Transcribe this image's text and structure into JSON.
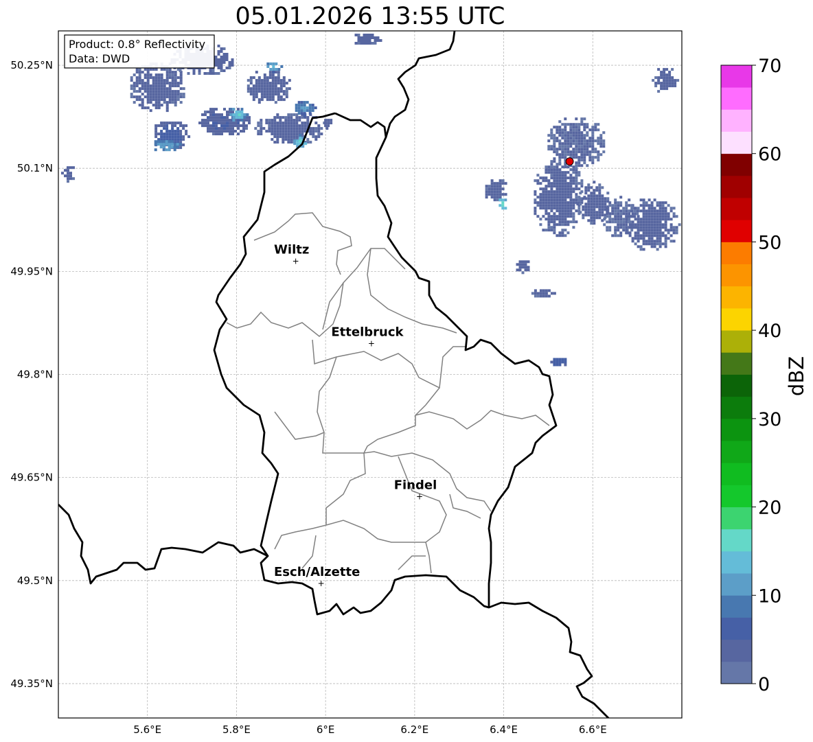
{
  "title": "05.01.2026 13:55 UTC",
  "info_box": {
    "line1": "Product: 0.8° Reflectivity",
    "line2": "Data: DWD"
  },
  "map": {
    "lon_range": [
      5.4,
      6.8
    ],
    "lat_range": [
      49.3,
      50.3
    ],
    "lon_ticks": [
      {
        "value": 5.6,
        "label": "5.6°E"
      },
      {
        "value": 5.8,
        "label": "5.8°E"
      },
      {
        "value": 6.0,
        "label": "6°E"
      },
      {
        "value": 6.2,
        "label": "6.2°E"
      },
      {
        "value": 6.4,
        "label": "6.4°E"
      },
      {
        "value": 6.6,
        "label": "6.6°E"
      }
    ],
    "lat_ticks": [
      {
        "value": 50.25,
        "label": "50.25°N"
      },
      {
        "value": 50.1,
        "label": "50.1°N"
      },
      {
        "value": 49.95,
        "label": "49.95°N"
      },
      {
        "value": 49.8,
        "label": "49.8°N"
      },
      {
        "value": 49.65,
        "label": "49.65°N"
      },
      {
        "value": 49.5,
        "label": "49.5°N"
      },
      {
        "value": 49.35,
        "label": "49.35°N"
      }
    ],
    "grid": true,
    "cities": [
      {
        "name": "Wiltz",
        "lon": 5.933,
        "lat": 49.966
      },
      {
        "name": "Ettelbruck",
        "lon": 6.103,
        "lat": 49.846
      },
      {
        "name": "Findel",
        "lon": 6.211,
        "lat": 49.623
      },
      {
        "name": "Esch/Alzette",
        "lon": 5.99,
        "lat": 49.497
      }
    ],
    "radar_site": {
      "lon": 6.548,
      "lat": 50.11,
      "color": "#e00000"
    }
  },
  "colorbar": {
    "label": "dBZ",
    "min": 0,
    "max": 70,
    "step": 2.5,
    "ticks": [
      {
        "value": 0,
        "label": "0"
      },
      {
        "value": 10,
        "label": "10"
      },
      {
        "value": 20,
        "label": "20"
      },
      {
        "value": 30,
        "label": "30"
      },
      {
        "value": 40,
        "label": "40"
      },
      {
        "value": 50,
        "label": "50"
      },
      {
        "value": 60,
        "label": "60"
      },
      {
        "value": 70,
        "label": "70"
      }
    ],
    "colors": [
      "#6577a8",
      "#5766a0",
      "#4660a6",
      "#4878b0",
      "#5c9ec8",
      "#64bcd8",
      "#64d8c8",
      "#3cd470",
      "#14c82c",
      "#10bc20",
      "#10a818",
      "#0c9410",
      "#0c7c0c",
      "#0c6408",
      "#447818",
      "#acb008",
      "#fcd400",
      "#fcb400",
      "#fc9400",
      "#fc7c00",
      "#e00000",
      "#c00000",
      "#a00000",
      "#800000",
      "#fde0ff",
      "#ffb2ff",
      "#ff6cff",
      "#e838e8"
    ]
  },
  "cells": [
    {
      "lon": 5.62,
      "lat": 50.22,
      "rx": 42,
      "ry": 38,
      "dbz": 3
    },
    {
      "lon": 5.65,
      "lat": 50.15,
      "rx": 30,
      "ry": 22,
      "dbz": 5
    },
    {
      "lon": 5.72,
      "lat": 50.26,
      "rx": 48,
      "ry": 24,
      "dbz": 3
    },
    {
      "lon": 5.77,
      "lat": 50.17,
      "rx": 40,
      "ry": 22,
      "dbz": 4
    },
    {
      "lon": 5.8,
      "lat": 50.18,
      "rx": 14,
      "ry": 12,
      "dbz": 14
    },
    {
      "lon": 5.64,
      "lat": 50.135,
      "rx": 24,
      "ry": 10,
      "dbz": 11
    },
    {
      "lon": 5.92,
      "lat": 50.16,
      "rx": 52,
      "ry": 24,
      "dbz": 3
    },
    {
      "lon": 5.94,
      "lat": 50.14,
      "rx": 12,
      "ry": 10,
      "dbz": 14
    },
    {
      "lon": 5.87,
      "lat": 50.22,
      "rx": 34,
      "ry": 26,
      "dbz": 3
    },
    {
      "lon": 5.95,
      "lat": 50.19,
      "rx": 16,
      "ry": 12,
      "dbz": 9
    },
    {
      "lon": 6.0,
      "lat": 50.17,
      "rx": 10,
      "ry": 10,
      "dbz": 4
    },
    {
      "lon": 5.88,
      "lat": 50.25,
      "rx": 12,
      "ry": 8,
      "dbz": 13
    },
    {
      "lon": 5.42,
      "lat": 50.095,
      "rx": 9,
      "ry": 16,
      "dbz": 3
    },
    {
      "lon": 6.09,
      "lat": 50.29,
      "rx": 24,
      "ry": 10,
      "dbz": 3
    },
    {
      "lon": 6.38,
      "lat": 50.07,
      "rx": 18,
      "ry": 18,
      "dbz": 3
    },
    {
      "lon": 6.395,
      "lat": 50.05,
      "rx": 8,
      "ry": 10,
      "dbz": 16
    },
    {
      "lon": 6.52,
      "lat": 50.06,
      "rx": 38,
      "ry": 60,
      "dbz": 3
    },
    {
      "lon": 6.56,
      "lat": 50.14,
      "rx": 44,
      "ry": 38,
      "dbz": 2
    },
    {
      "lon": 6.6,
      "lat": 50.05,
      "rx": 24,
      "ry": 32,
      "dbz": 3
    },
    {
      "lon": 6.73,
      "lat": 50.02,
      "rx": 40,
      "ry": 40,
      "dbz": 3
    },
    {
      "lon": 6.66,
      "lat": 50.03,
      "rx": 28,
      "ry": 30,
      "dbz": 2
    },
    {
      "lon": 6.76,
      "lat": 50.23,
      "rx": 18,
      "ry": 20,
      "dbz": 3
    },
    {
      "lon": 6.49,
      "lat": 49.92,
      "rx": 18,
      "ry": 8,
      "dbz": 3
    },
    {
      "lon": 6.52,
      "lat": 49.82,
      "rx": 14,
      "ry": 8,
      "dbz": 6
    },
    {
      "lon": 6.44,
      "lat": 49.96,
      "rx": 12,
      "ry": 10,
      "dbz": 3
    }
  ]
}
